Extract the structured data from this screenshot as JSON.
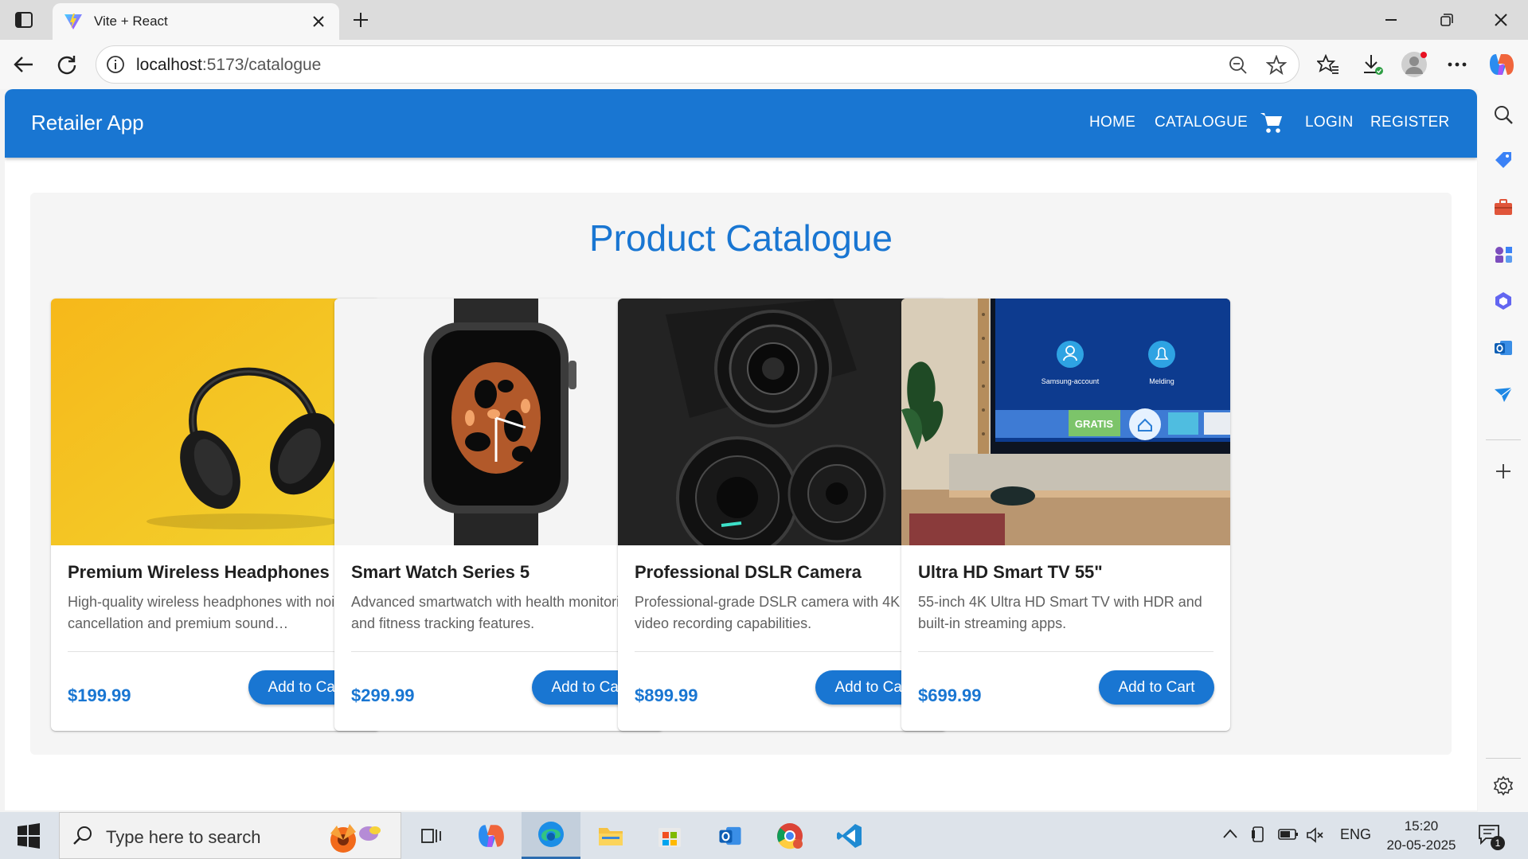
{
  "browser": {
    "tab_title": "Vite + React",
    "url_host": "localhost",
    "url_path": ":5173/catalogue"
  },
  "app": {
    "brand": "Retailer App",
    "nav": {
      "home": "HOME",
      "catalogue": "CATALOGUE",
      "login": "LOGIN",
      "register": "REGISTER"
    }
  },
  "catalogue": {
    "title": "Product Catalogue",
    "add_label": "Add to Cart",
    "products": [
      {
        "name": "Premium Wireless Headphones",
        "description": "High-quality wireless headphones with noise cancellation and premium sound…",
        "price": "$199.99"
      },
      {
        "name": "Smart Watch Series 5",
        "description": "Advanced smartwatch with health monitoring and fitness tracking features.",
        "price": "$299.99"
      },
      {
        "name": "Professional DSLR Camera",
        "description": "Professional-grade DSLR camera with 4K video recording capabilities.",
        "price": "$899.99"
      },
      {
        "name": "Ultra HD Smart TV 55\"",
        "description": "55-inch 4K Ultra HD Smart TV with HDR and built-in streaming apps.",
        "price": "$699.99"
      }
    ],
    "tv_screen": {
      "account": "Samsung-account",
      "notifications": "Melding",
      "promo": "GRATIS"
    }
  },
  "taskbar": {
    "search_placeholder": "Type here to search",
    "language": "ENG",
    "time": "15:20",
    "date": "20-05-2025",
    "notification_count": "1"
  },
  "colors": {
    "primary": "#1976d2",
    "panel_bg": "#f5f5f5"
  }
}
